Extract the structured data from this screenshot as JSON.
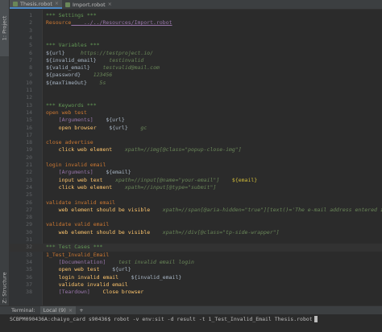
{
  "sidebar": {
    "project_tab": "1: Project",
    "structure_tab": "Z: Structure"
  },
  "tabs": [
    {
      "label": "Thesis.robot",
      "active": true
    },
    {
      "label": "Import.robot",
      "active": false
    }
  ],
  "code_lines": [
    {
      "n": "1",
      "segs": [
        {
          "c": "c-hdr",
          "t": "*** Settings ***"
        }
      ]
    },
    {
      "n": "2",
      "segs": [
        {
          "c": "c-kw",
          "t": "Resource"
        },
        {
          "c": "c-set",
          "t": "    ../../Resources/Import.robot"
        }
      ]
    },
    {
      "n": "3",
      "segs": []
    },
    {
      "n": "4",
      "segs": []
    },
    {
      "n": "5",
      "segs": [
        {
          "c": "c-hdr",
          "t": "*** Variables ***"
        }
      ]
    },
    {
      "n": "6",
      "segs": [
        {
          "c": "c-var",
          "t": "${url}"
        },
        {
          "c": "c-val",
          "t": "     https://testproject.io/"
        }
      ]
    },
    {
      "n": "7",
      "segs": [
        {
          "c": "c-var",
          "t": "${invalid_email}"
        },
        {
          "c": "c-val",
          "t": "    testinvalid"
        }
      ]
    },
    {
      "n": "8",
      "segs": [
        {
          "c": "c-var",
          "t": "${valid_email}"
        },
        {
          "c": "c-val",
          "t": "    testvalid@mail.com"
        }
      ]
    },
    {
      "n": "9",
      "segs": [
        {
          "c": "c-var",
          "t": "${password}"
        },
        {
          "c": "c-val",
          "t": "    123456"
        }
      ]
    },
    {
      "n": "10",
      "segs": [
        {
          "c": "c-var",
          "t": "${maxTimeOut}"
        },
        {
          "c": "c-val",
          "t": "    5s"
        }
      ]
    },
    {
      "n": "11",
      "segs": []
    },
    {
      "n": "12",
      "segs": []
    },
    {
      "n": "13",
      "segs": [
        {
          "c": "c-hdr",
          "t": "*** Keywords ***"
        }
      ]
    },
    {
      "n": "14",
      "segs": [
        {
          "c": "c-tc",
          "t": "open web test"
        }
      ]
    },
    {
      "n": "15",
      "segs": [
        {
          "c": "c-ex",
          "t": "    [Arguments]"
        },
        {
          "c": "c-var",
          "t": "    ${url}"
        }
      ]
    },
    {
      "n": "16",
      "segs": [
        {
          "c": "c-call",
          "t": "    open browser"
        },
        {
          "c": "c-var",
          "t": "    ${url}"
        },
        {
          "c": "c-val",
          "t": "    gc"
        }
      ]
    },
    {
      "n": "17",
      "segs": []
    },
    {
      "n": "18",
      "segs": [
        {
          "c": "c-tc",
          "t": "close advertise"
        }
      ]
    },
    {
      "n": "19",
      "segs": [
        {
          "c": "c-call",
          "t": "    click web element"
        },
        {
          "c": "c-xp",
          "t": "    xpath=//img[@class=\"popup-close-img\"]"
        }
      ]
    },
    {
      "n": "20",
      "segs": []
    },
    {
      "n": "21",
      "segs": [
        {
          "c": "c-tc",
          "t": "login invalid email"
        }
      ]
    },
    {
      "n": "22",
      "segs": [
        {
          "c": "c-ex",
          "t": "    [Arguments]"
        },
        {
          "c": "c-var",
          "t": "    ${email}"
        }
      ]
    },
    {
      "n": "23",
      "segs": [
        {
          "c": "c-call",
          "t": "    input web text"
        },
        {
          "c": "c-xp",
          "t": "    xpath=//input[@name=\"your-email\"]"
        },
        {
          "c": "c-arg",
          "t": "    ${email}"
        }
      ]
    },
    {
      "n": "24",
      "segs": [
        {
          "c": "c-call",
          "t": "    click web element"
        },
        {
          "c": "c-xp",
          "t": "    xpath=//input[@type=\"submit\"]"
        }
      ]
    },
    {
      "n": "25",
      "segs": []
    },
    {
      "n": "26",
      "segs": [
        {
          "c": "c-tc",
          "t": "validate invalid email"
        }
      ]
    },
    {
      "n": "27",
      "segs": [
        {
          "c": "c-warn",
          "t": "    web element should be visible"
        },
        {
          "c": "c-xp",
          "t": "    xpath=//span[@aria-hidden=\"true\"][text()='The e-mail address entered is invalid.']"
        }
      ]
    },
    {
      "n": "28",
      "segs": []
    },
    {
      "n": "29",
      "segs": [
        {
          "c": "c-tc",
          "t": "validate valid email"
        }
      ]
    },
    {
      "n": "30",
      "segs": [
        {
          "c": "c-warn",
          "t": "    web element should be visible"
        },
        {
          "c": "c-xp",
          "t": "    xpath=//div[@class=\"tp-side-wrapper\"]"
        }
      ]
    },
    {
      "n": "31",
      "segs": []
    },
    {
      "n": "32",
      "segs": [
        {
          "c": "c-hdr",
          "t": "*** Test Cases ***"
        }
      ],
      "caret": true
    },
    {
      "n": "33",
      "segs": [
        {
          "c": "c-tc",
          "t": "1_Test_Invalid_Email"
        }
      ]
    },
    {
      "n": "34",
      "segs": [
        {
          "c": "c-ex",
          "t": "    [Documentation]"
        },
        {
          "c": "c-val",
          "t": "    test invalid email login"
        }
      ]
    },
    {
      "n": "35",
      "segs": [
        {
          "c": "c-call",
          "t": "    open web test"
        },
        {
          "c": "c-var",
          "t": "    ${url}"
        }
      ]
    },
    {
      "n": "36",
      "segs": [
        {
          "c": "c-call",
          "t": "    login invalid email"
        },
        {
          "c": "c-var",
          "t": "    ${invalid_email}"
        }
      ]
    },
    {
      "n": "37",
      "segs": [
        {
          "c": "c-call",
          "t": "    validate invalid email"
        }
      ]
    },
    {
      "n": "38",
      "segs": [
        {
          "c": "c-ex",
          "t": "    [Teardown]"
        },
        {
          "c": "c-call",
          "t": "    Close browser"
        }
      ]
    }
  ],
  "terminal": {
    "label": "Terminal:",
    "tab_label": "Local (9)",
    "tab_close": "×",
    "add": "+",
    "command_line": "SCBPM090436A:chaiyo_card s90436$ robot -v env:sit -d result -t 1_Test_Invalid_Email Thesis.robot"
  },
  "colors": {
    "background": "#2b2b2b",
    "panel": "#3c3f41",
    "keyword": "#cc7832",
    "string": "#6a8759",
    "header": "#629755"
  }
}
